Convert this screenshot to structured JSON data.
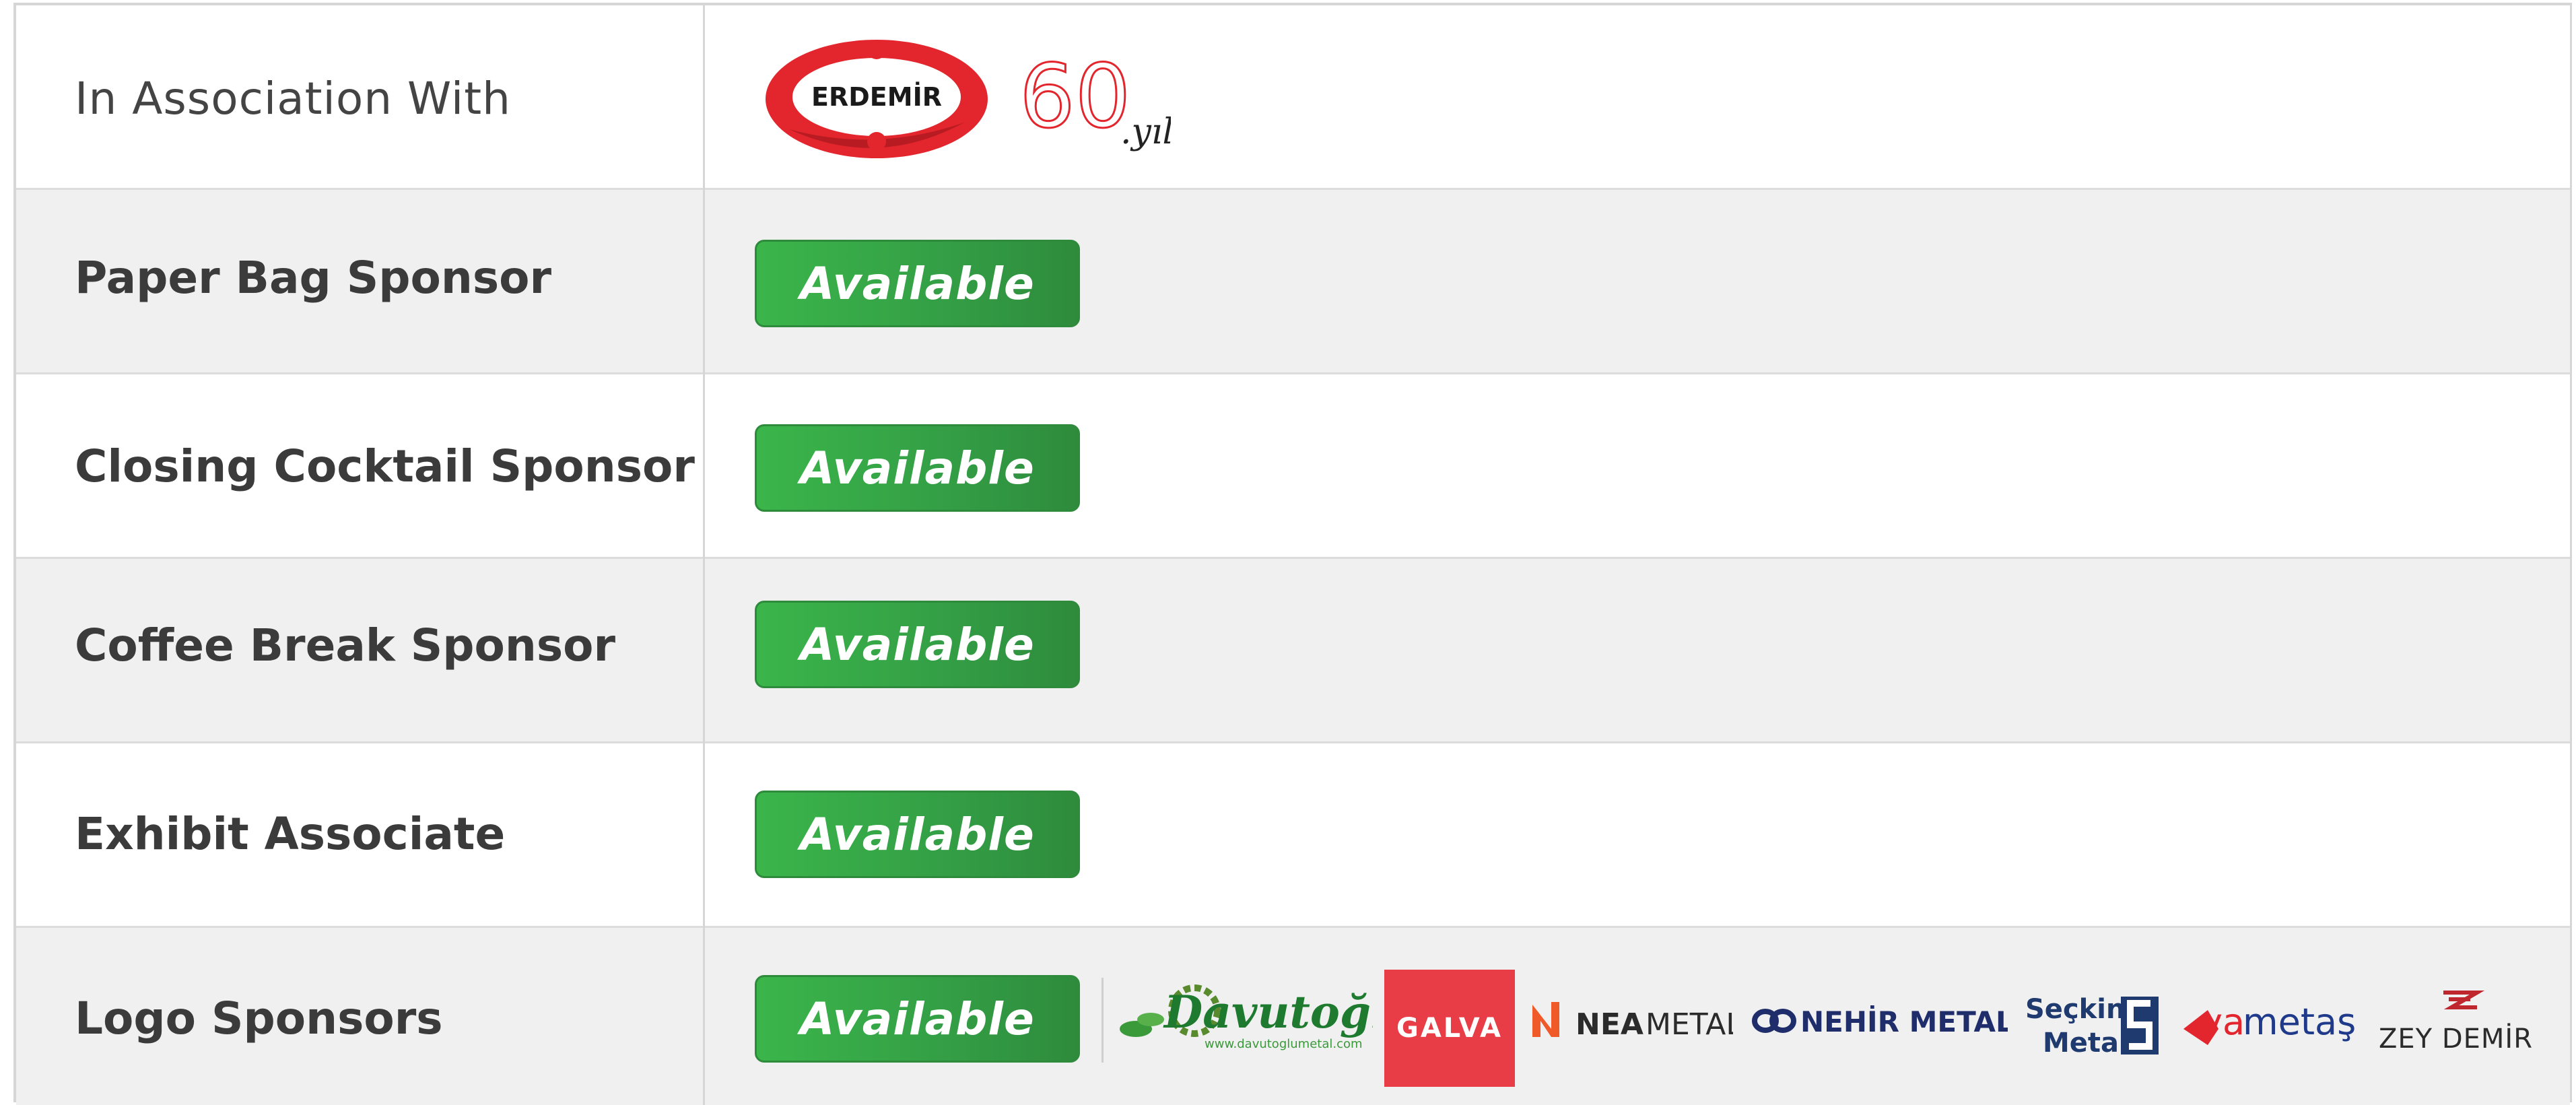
{
  "rows": [
    {
      "label": "In Association With"
    },
    {
      "label": "Paper Bag Sponsor",
      "button": "Available"
    },
    {
      "label": "Closing Cocktail Sponsor",
      "button": "Available"
    },
    {
      "label": "Coffee Break Sponsor",
      "button": "Available"
    },
    {
      "label": "Exhibit Associate",
      "button": "Available"
    },
    {
      "label": "Logo Sponsors",
      "button": "Available"
    }
  ],
  "association_logos": {
    "erdemir": "ERDEMİR",
    "anniversary_number": "60",
    "anniversary_suffix": ".yıl"
  },
  "sponsor_logos": {
    "davutoglu": "Davutoğlu",
    "davutoglu_url": "www.davutoglumetal.com",
    "galva": "GALVA",
    "nea_metal_bold": "NEA",
    "nea_metal_light": "METAL",
    "nehir_metal": "NEHİR METAL",
    "seckin_line1": "Seçkin",
    "seckin_line2": "Metal",
    "yametas_prefix": "ya",
    "yametas_rest": "metaş",
    "zey_demir": "ZEY DEMİR"
  },
  "colors": {
    "button_green": "#34a046",
    "erdemir_red": "#e3262d",
    "galva_red": "#e83c46",
    "nehir_navy": "#1f2d6b",
    "davutoglu_green": "#1e7a2e"
  }
}
